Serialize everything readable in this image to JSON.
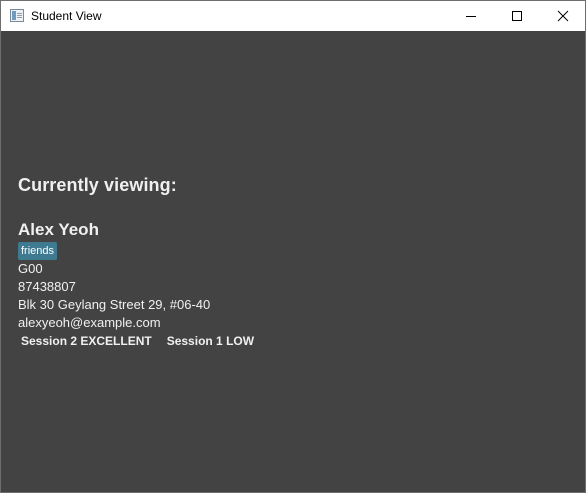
{
  "window": {
    "title": "Student View",
    "app_icon": "window-app-icon",
    "controls": {
      "minimize_icon": "minimize-icon",
      "maximize_icon": "maximize-icon",
      "close_icon": "close-icon"
    }
  },
  "main": {
    "heading": "Currently viewing:",
    "student": {
      "name": "Alex Yeoh",
      "tags": [
        "friends"
      ],
      "group": "G00",
      "phone": "87438807",
      "address": "Blk 30 Geylang Street 29, #06-40",
      "email": "alexyeoh@example.com",
      "sessions": [
        "Session 2 EXCELLENT",
        "Session 1 LOW"
      ]
    }
  },
  "colors": {
    "background": "#434343",
    "titlebar": "#ffffff",
    "tag_background": "#3e7b91",
    "text": "#f0f0f0"
  }
}
